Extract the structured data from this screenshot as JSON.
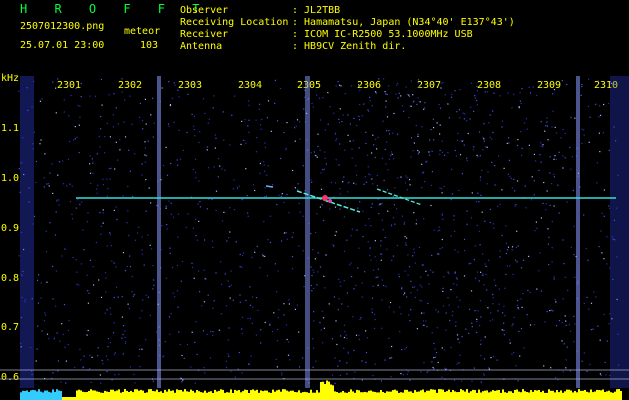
{
  "header": {
    "app_name": "H R O F F T",
    "filename": "2507012300.png",
    "mode_label": "meteor",
    "datetime": "25.07.01 23:00",
    "count": "103",
    "fields": [
      {
        "label": "Observer",
        "value": ": JL2TBB"
      },
      {
        "label": "Receiving Location",
        "value": ": Hamamatsu, Japan (N34°40' E137°43')"
      },
      {
        "label": "Receiver",
        "value": ": ICOM IC-R2500 53.1000MHz USB"
      },
      {
        "label": "Antenna",
        "value": ": HB9CV Zenith dir."
      }
    ]
  },
  "axis": {
    "unit_label": "kHz",
    "time_ticks": [
      "2301",
      "2302",
      "2303",
      "2304",
      "2305",
      "2306",
      "2307",
      "2308",
      "2309",
      "2310"
    ],
    "freq_ticks": [
      "1.1",
      "1.0",
      "0.9",
      "0.8",
      "0.7",
      "0.6"
    ]
  },
  "colors": {
    "background": "#000000",
    "noise": "#2233cc",
    "carrier": "#33dddd",
    "text": "#ffff00",
    "title_green": "#00ff3c",
    "bottom_bar": "#ffff00"
  }
}
